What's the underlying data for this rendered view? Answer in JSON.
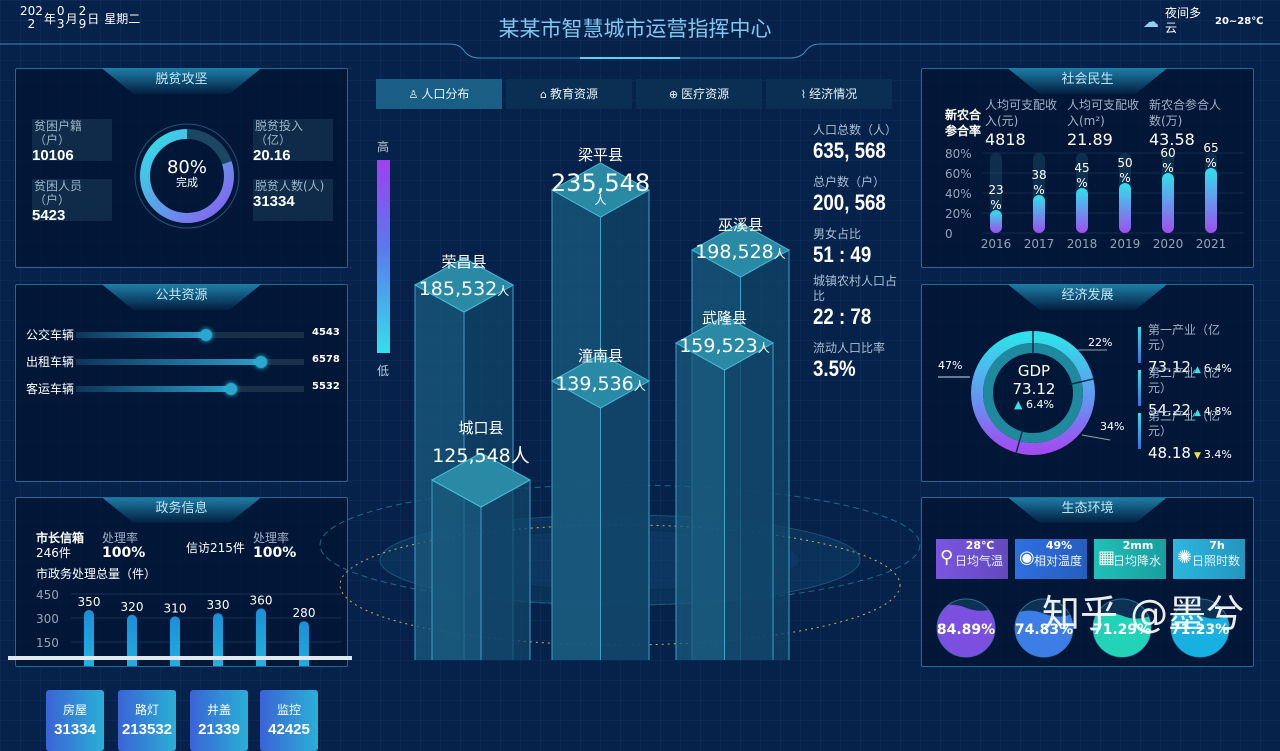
{
  "header": {
    "date_year_a": "202",
    "date_year_b": "2",
    "date_year_label": "年",
    "date_month_a": "0",
    "date_month_b": "3",
    "date_month_label": "月",
    "date_day_a": "2",
    "date_day_b": "9",
    "date_day_label": "日",
    "weekday": "星期二",
    "title": "某某市智慧城市运营指挥中心",
    "weather": "夜间多云",
    "temp": "20~28℃",
    "weather_icon": "cloud-moon-icon"
  },
  "poverty": {
    "title": "脱贫攻坚",
    "items": [
      {
        "label": "贫困户籍（户）",
        "value": "10106"
      },
      {
        "label": "贫困人员（户）",
        "value": "5423"
      },
      {
        "label": "脱贫投入（亿）",
        "value": "20.16"
      },
      {
        "label": "脱贫人数(人)",
        "value": "31334"
      }
    ],
    "ring_percent": "80%",
    "ring_label": "完成",
    "ring_fraction": 0.8
  },
  "public": {
    "title": "公共资源",
    "sliders": [
      {
        "label": "公交车辆",
        "value": "4543",
        "fraction": 0.57
      },
      {
        "label": "出租车辆",
        "value": "6578",
        "fraction": 0.81
      },
      {
        "label": "客运车辆",
        "value": "5532",
        "fraction": 0.68
      }
    ],
    "cards": [
      {
        "label": "房屋",
        "value": "31334"
      },
      {
        "label": "路灯",
        "value": "213532"
      },
      {
        "label": "井盖",
        "value": "21339"
      },
      {
        "label": "监控",
        "value": "42425"
      }
    ]
  },
  "gov": {
    "title": "政务信息",
    "mailbox_label": "市长信箱",
    "mailbox_count": "246件",
    "rate_label": "处理率",
    "rate1": "100%",
    "petition": "信访215件",
    "rate2": "100%",
    "chart_title": "市政务处理总量（件）"
  },
  "tabs": [
    {
      "label": "人口分布",
      "icon": "user-icon"
    },
    {
      "label": "教育资源",
      "icon": "graduation-cap-icon"
    },
    {
      "label": "医疗资源",
      "icon": "medical-kit-icon"
    },
    {
      "label": "经济情况",
      "icon": "line-chart-icon"
    }
  ],
  "legend": {
    "high": "高",
    "low": "低"
  },
  "districts": [
    {
      "name": "梁平县",
      "value": "235,548",
      "unit": "人"
    },
    {
      "name": "巫溪县",
      "value": "198,528",
      "unit": "人"
    },
    {
      "name": "荣昌县",
      "value": "185,532",
      "unit": "人"
    },
    {
      "name": "武隆县",
      "value": "159,523",
      "unit": "人"
    },
    {
      "name": "潼南县",
      "value": "139,536",
      "unit": "人"
    },
    {
      "name": "城口县",
      "value": "125,548",
      "unit": "人"
    }
  ],
  "stats": [
    {
      "label": "人口总数（人）",
      "value": "635, 568"
    },
    {
      "label": "总户数（户）",
      "value": "200, 568"
    },
    {
      "label": "男女占比",
      "value": "51 : 49"
    },
    {
      "label": "城镇农村人口占比",
      "value": "22 : 78"
    },
    {
      "label": "流动人口比率",
      "value": "3.5%"
    }
  ],
  "social": {
    "title": "社会民生",
    "rate_label": "新农合参合率",
    "metrics": [
      {
        "label": "人均可支配收入(元)",
        "value": "4818"
      },
      {
        "label": "人均可支配收入(m²)",
        "value": "21.89"
      },
      {
        "label": "新农合参合人数(万)",
        "value": "43.58"
      }
    ]
  },
  "economy": {
    "title": "经济发展",
    "gdp_label": "GDP",
    "gdp_value": "73.12",
    "gdp_change": "6.4%",
    "industries": [
      {
        "label": "第一产业（亿元）",
        "value": "73.12",
        "change": "6.4%",
        "trend": "up"
      },
      {
        "label": "第二产业（亿元）",
        "value": "54.22",
        "change": "4.8%",
        "trend": "up"
      },
      {
        "label": "第三产业（亿元）",
        "value": "48.18",
        "change": "3.4%",
        "trend": "down"
      }
    ]
  },
  "ecology": {
    "title": "生态环境",
    "cards": [
      {
        "label": "日均气温",
        "value": "28℃",
        "icon": "thermometer-icon",
        "color": "#7b55e0"
      },
      {
        "label": "相对温度",
        "value": "49%",
        "icon": "water-drop-icon",
        "color": "#2f6fe0"
      },
      {
        "label": "日均降水",
        "value": "2mm",
        "icon": "rain-gauge-icon",
        "color": "#1fc0b8"
      },
      {
        "label": "日照时数",
        "value": "7h",
        "icon": "sun-icon",
        "color": "#2bb6e0"
      }
    ],
    "gauges": [
      {
        "value": "84.89%",
        "fraction": 0.8489,
        "color": "#7b4fe0"
      },
      {
        "value": "74.83%",
        "fraction": 0.7483,
        "color": "#3d7ee6"
      },
      {
        "value": "71.29%",
        "fraction": 0.7129,
        "color": "#22d3b8"
      },
      {
        "value": "71.23%",
        "fraction": 0.7123,
        "color": "#17b0e0"
      }
    ]
  },
  "watermark": "知乎 @墨兮",
  "chart_data": [
    {
      "type": "bar",
      "title": "",
      "categories": [
        "2016",
        "2017",
        "2018",
        "2019",
        "2020",
        "2021"
      ],
      "values": [
        23,
        38,
        45,
        50,
        60,
        65
      ],
      "value_labels": [
        "23%",
        "38%",
        "45%",
        "50%",
        "60%",
        "65%"
      ],
      "ylim": [
        0,
        80
      ],
      "yticks": [
        "80%",
        "60%",
        "40%",
        "20%",
        "0"
      ],
      "ylabel": "新农合参合率"
    },
    {
      "type": "bar",
      "title": "市政务处理总量（件）",
      "values": [
        350,
        320,
        310,
        330,
        360,
        280
      ],
      "yticks": [
        450,
        300,
        150
      ]
    },
    {
      "type": "pie",
      "title": "GDP",
      "values": [
        22,
        34,
        47
      ],
      "labels": [
        "22%",
        "34%",
        "47%"
      ]
    }
  ]
}
